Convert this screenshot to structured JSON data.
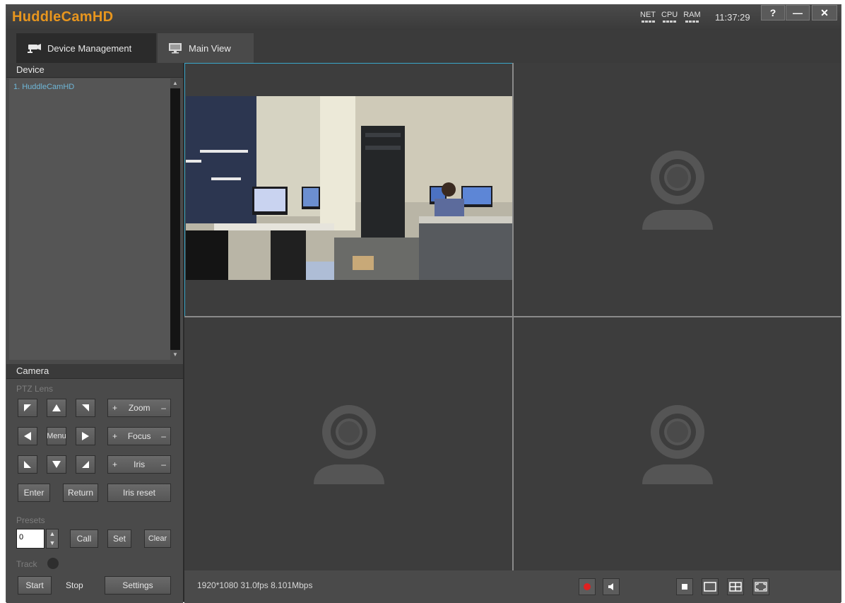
{
  "app": {
    "title": "HuddleCamHD",
    "accent_color": "#e8961e"
  },
  "titlebar": {
    "meters": [
      {
        "label": "NET"
      },
      {
        "label": "CPU"
      },
      {
        "label": "RAM"
      }
    ],
    "clock": "11:37:29",
    "buttons": {
      "help": "?",
      "minimize": "—",
      "close": "✕"
    }
  },
  "tabs": [
    {
      "label": "Device Management",
      "icon": "camera-cctv-icon",
      "active": true
    },
    {
      "label": "Main View",
      "icon": "monitor-icon",
      "active": false
    }
  ],
  "device_panel": {
    "heading": "Device",
    "items": [
      {
        "label": "1. HuddleCamHD"
      }
    ]
  },
  "camera_panel": {
    "heading": "Camera",
    "ptz_label": "PTZ Lens",
    "menu_label": "Menu",
    "zoom": {
      "plus": "+",
      "label": "Zoom",
      "minus": "–"
    },
    "focus": {
      "plus": "+",
      "label": "Focus",
      "minus": "–"
    },
    "iris": {
      "plus": "+",
      "label": "Iris",
      "minus": "–"
    },
    "enter_label": "Enter",
    "return_label": "Return",
    "iris_reset_label": "Iris reset",
    "presets_label": "Presets",
    "preset_value": "0",
    "call_label": "Call",
    "set_label": "Set",
    "clear_label": "Clear",
    "track_label": "Track",
    "start_label": "Start",
    "stop_label": "Stop",
    "settings_label": "Settings"
  },
  "video": {
    "selected_border_color": "#3aa6c9",
    "status": "1920*1080 31.0fps 8.101Mbps"
  },
  "bottom_controls": [
    {
      "icon": "record-icon",
      "color": "#e02020"
    },
    {
      "icon": "audio-icon"
    },
    {
      "icon": "layout-fill-icon"
    },
    {
      "icon": "layout-single-icon"
    },
    {
      "icon": "layout-quad-icon"
    },
    {
      "icon": "fullscreen-icon"
    }
  ]
}
